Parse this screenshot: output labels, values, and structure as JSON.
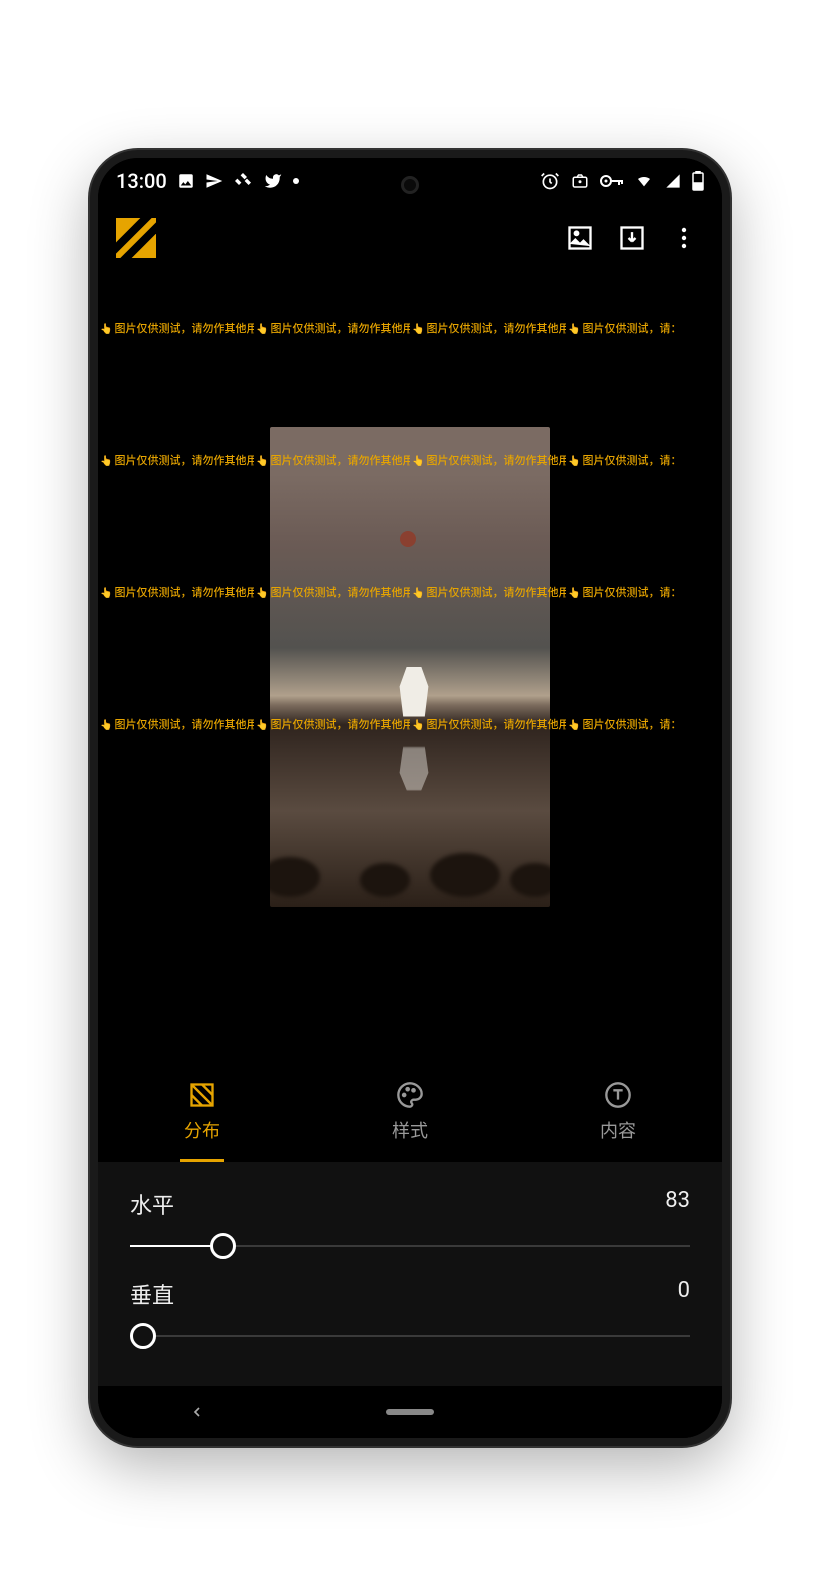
{
  "statusbar": {
    "time": "13:00",
    "icons_left": [
      "image-icon",
      "telegram-icon",
      "feed-icon",
      "twitter-icon",
      "dot-icon"
    ],
    "icons_right": [
      "alarm-icon",
      "camera-icon",
      "vpn-key-icon",
      "wifi-icon",
      "signal-icon",
      "battery-icon"
    ]
  },
  "toolbar": {
    "logo": "app-logo",
    "actions": [
      "gallery-icon",
      "download-icon",
      "more-icon"
    ]
  },
  "watermark": {
    "text": "图片仅供测试，请勿作其他用途",
    "text_truncated": "图片仅供测试，请：",
    "rows": 4,
    "cols": 4
  },
  "tabs": [
    {
      "id": "distribution",
      "label": "分布",
      "icon": "grid-icon",
      "active": true
    },
    {
      "id": "style",
      "label": "样式",
      "icon": "palette-icon",
      "active": false
    },
    {
      "id": "content",
      "label": "内容",
      "icon": "text-circle-icon",
      "active": false
    }
  ],
  "sliders": [
    {
      "id": "horizontal",
      "label": "水平",
      "value": 83,
      "min": 0,
      "max": 500
    },
    {
      "id": "vertical",
      "label": "垂直",
      "value": 0,
      "min": 0,
      "max": 500
    }
  ],
  "colors": {
    "accent": "#e6a400",
    "bg": "#000000",
    "panel": "#111111"
  }
}
